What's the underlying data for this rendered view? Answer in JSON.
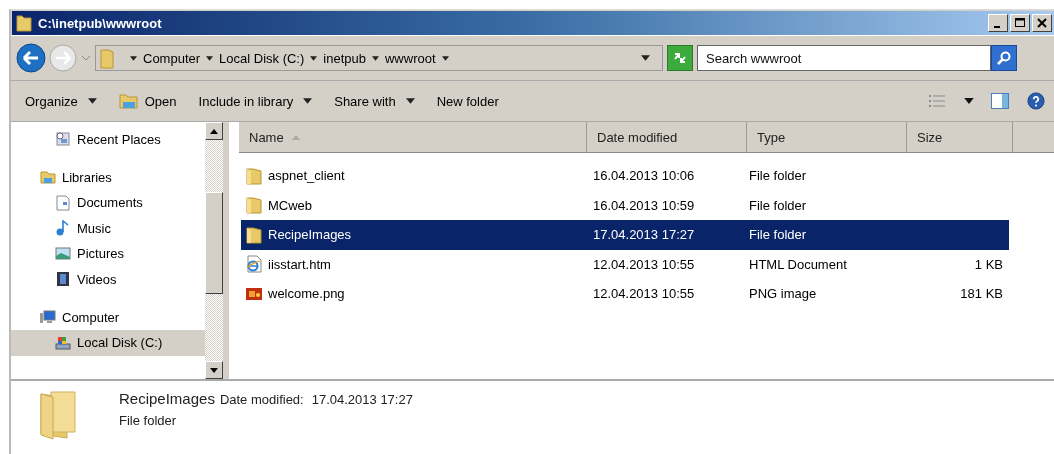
{
  "window": {
    "title": "C:\\inetpub\\wwwroot"
  },
  "address": {
    "crumbs": [
      "Computer",
      "Local Disk (C:)",
      "inetpub",
      "wwwroot"
    ]
  },
  "search": {
    "placeholder": "Search wwwroot"
  },
  "toolbar": [
    {
      "label": "Organize",
      "kind": "menu"
    },
    {
      "label": "Open",
      "kind": "open"
    },
    {
      "label": "Include in library",
      "kind": "menu"
    },
    {
      "label": "Share with",
      "kind": "menu"
    },
    {
      "label": "New folder",
      "kind": "plain"
    }
  ],
  "sidebar": {
    "items": [
      {
        "label": "Recent Places",
        "kind": "recent",
        "selected": false
      },
      {
        "label": "Libraries",
        "kind": "library",
        "selected": false,
        "children": [
          {
            "label": "Documents",
            "kind": "documents",
            "selected": false
          },
          {
            "label": "Music",
            "kind": "music",
            "selected": false
          },
          {
            "label": "Pictures",
            "kind": "pictures",
            "selected": false
          },
          {
            "label": "Videos",
            "kind": "videos",
            "selected": false
          }
        ]
      },
      {
        "label": "Computer",
        "kind": "computer",
        "selected": false,
        "children": [
          {
            "label": "Local Disk (C:)",
            "kind": "disk",
            "selected": true
          }
        ]
      }
    ]
  },
  "table": {
    "columns": [
      "Name",
      "Date modified",
      "Type",
      "Size"
    ],
    "rows": [
      {
        "kind": "folder",
        "name": "aspnet_client",
        "date": "16.04.2013 10:06",
        "type": "File folder",
        "selected": false
      },
      {
        "kind": "folder",
        "name": "MCweb",
        "date": "16.04.2013 10:59",
        "type": "File folder",
        "selected": false
      },
      {
        "kind": "folder",
        "name": "RecipeImages",
        "date": "17.04.2013 17:27",
        "type": "File folder",
        "selected": true
      },
      {
        "kind": "html",
        "name": "iisstart.htm",
        "date": "12.04.2013 10:55",
        "type": "HTML Document",
        "size": "1 KB",
        "selected": false
      },
      {
        "kind": "image",
        "name": "welcome.png",
        "date": "12.04.2013 10:55",
        "type": "PNG image",
        "size": "181 KB",
        "selected": false
      }
    ]
  },
  "details": {
    "name": "RecipeImages",
    "label": "Date modified:",
    "value": "17.04.2013 17:27",
    "type": "File folder"
  }
}
